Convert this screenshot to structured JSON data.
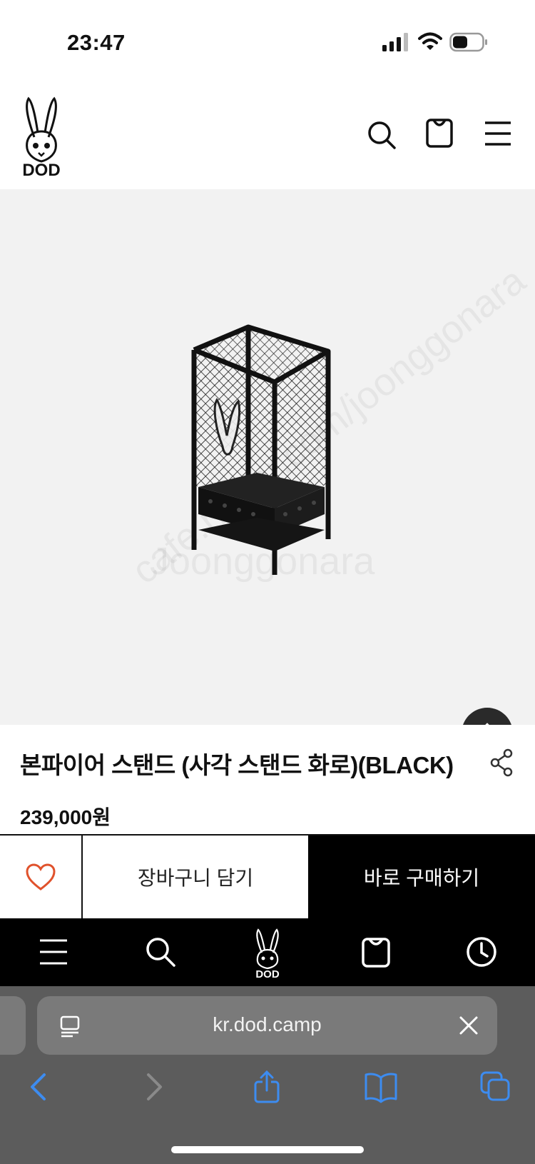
{
  "status_bar": {
    "time": "23:47"
  },
  "header": {
    "logo_text": "DOD",
    "icons": [
      "search-icon",
      "bag-icon",
      "menu-icon"
    ]
  },
  "product": {
    "title": "본파이어 스탠드 (사각 스탠드 화로)(BLACK)",
    "price": "239,000원"
  },
  "watermark": {
    "lines": [
      "cafe.naver.com/joonggonara",
      "Joonggonara"
    ]
  },
  "actions": {
    "cart_label": "장바구니 담기",
    "buy_now_label": "바로 구매하기"
  },
  "bottom_nav": {
    "logo_text": "DOD",
    "items": [
      "menu-icon",
      "search-icon",
      "logo",
      "bag-icon",
      "clock-icon"
    ]
  },
  "browser": {
    "url": "kr.dod.camp",
    "toolbar": [
      "back-icon",
      "forward-icon",
      "share-icon",
      "bookmarks-icon",
      "tabs-icon"
    ]
  },
  "colors": {
    "accent_heart": "#e0522c",
    "toolbar_blue": "#3d8cf0",
    "safari_bg": "#5c5c5c",
    "image_bg": "#f2f2f2"
  }
}
